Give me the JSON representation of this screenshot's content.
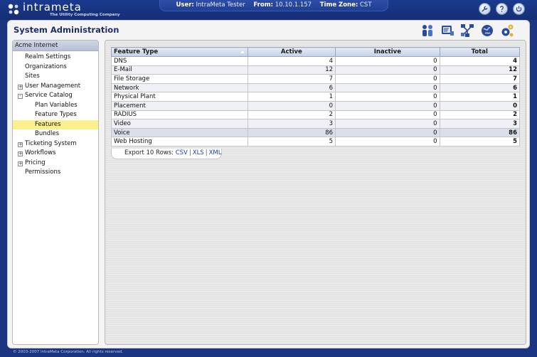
{
  "brand": {
    "name": "intrameta",
    "tagline": "The Utility Computing Company"
  },
  "session": {
    "user_label": "User:",
    "user_value": "IntraMeta Tester",
    "from_label": "From:",
    "from_value": "10.10.1.157",
    "tz_label": "Time Zone:",
    "tz_value": "CST"
  },
  "top_icons": [
    "wrench-icon",
    "help-icon",
    "power-icon"
  ],
  "page": {
    "title": "System Administration"
  },
  "admin_icons": [
    "users-icon",
    "console-icon",
    "network-icon",
    "globe-icon",
    "settings-icon"
  ],
  "sidebar": {
    "header": "Acme Internet",
    "items": [
      {
        "label": "Realm Settings",
        "level": 1
      },
      {
        "label": "Organizations",
        "level": 1
      },
      {
        "label": "Sites",
        "level": 1
      },
      {
        "label": "User Management",
        "level": 1,
        "toggle": "+"
      },
      {
        "label": "Service Catalog",
        "level": 1,
        "toggle": "-"
      },
      {
        "label": "Plan Variables",
        "level": 2
      },
      {
        "label": "Feature Types",
        "level": 2
      },
      {
        "label": "Features",
        "level": 2,
        "selected": true
      },
      {
        "label": "Bundles",
        "level": 2
      },
      {
        "label": "Ticketing System",
        "level": 1,
        "toggle": "+"
      },
      {
        "label": "Workflows",
        "level": 1,
        "toggle": "+"
      },
      {
        "label": "Pricing",
        "level": 1,
        "toggle": "+"
      },
      {
        "label": "Permissions",
        "level": 1
      }
    ]
  },
  "grid": {
    "columns": [
      "Feature Type",
      "Active",
      "Inactive",
      "Total"
    ],
    "rows": [
      {
        "feature": "DNS",
        "active": "4",
        "inactive": "0",
        "total": "4"
      },
      {
        "feature": "E-Mail",
        "active": "12",
        "inactive": "0",
        "total": "12"
      },
      {
        "feature": "File Storage",
        "active": "7",
        "inactive": "0",
        "total": "7"
      },
      {
        "feature": "Network",
        "active": "6",
        "inactive": "0",
        "total": "6"
      },
      {
        "feature": "Physical Plant",
        "active": "1",
        "inactive": "0",
        "total": "1"
      },
      {
        "feature": "Placement",
        "active": "0",
        "inactive": "0",
        "total": "0"
      },
      {
        "feature": "RADIUS",
        "active": "2",
        "inactive": "0",
        "total": "2"
      },
      {
        "feature": "Video",
        "active": "3",
        "inactive": "0",
        "total": "3"
      },
      {
        "feature": "Voice",
        "active": "86",
        "inactive": "0",
        "total": "86"
      },
      {
        "feature": "Web Hosting",
        "active": "5",
        "inactive": "0",
        "total": "5"
      }
    ]
  },
  "export": {
    "label": "Export 10 Rows:",
    "csv": "CSV",
    "xls": "XLS",
    "xml": "XML"
  },
  "footer": {
    "copyright": "© 2003-2007 IntraMeta Corporation. All rights reserved."
  },
  "colors": {
    "background": "#1c3580",
    "header": "#1b3a8e",
    "title": "#1e2f66",
    "selected": "#fbf08e",
    "link": "#1c3d9c"
  }
}
